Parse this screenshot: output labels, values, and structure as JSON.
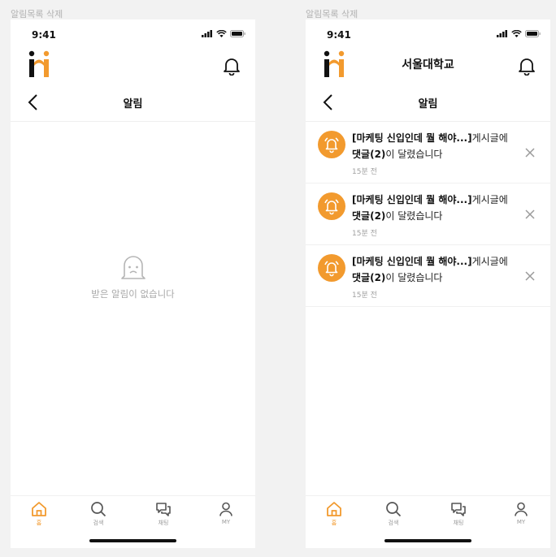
{
  "colors": {
    "accent": "#f29a2e",
    "logo_dark": "#111111"
  },
  "frames": [
    {
      "label": "알림목록 삭제",
      "status_time": "9:41",
      "header_title": "",
      "page_title": "알림",
      "empty_text": "받은 알림이 없습니다",
      "tabs": [
        "홈",
        "검색",
        "채팅",
        "MY"
      ]
    },
    {
      "label": "알림목록 삭제",
      "status_time": "9:41",
      "header_title": "서울대학교",
      "page_title": "알림",
      "notifications": [
        {
          "post_title": "[마케팅 신입인데 뭘 해야...]",
          "suffix_1": "게시글에",
          "comment": "댓글(2)",
          "suffix_2": "이 달렸습니다",
          "time": "15분 전"
        },
        {
          "post_title": "[마케팅 신입인데 뭘 해야...]",
          "suffix_1": "게시글에",
          "comment": "댓글(2)",
          "suffix_2": "이 달렸습니다",
          "time": "15분 전"
        },
        {
          "post_title": "[마케팅 신입인데 뭘 해야...]",
          "suffix_1": "게시글에",
          "comment": "댓글(2)",
          "suffix_2": "이 달렸습니다",
          "time": "15분 전"
        }
      ],
      "tabs": [
        "홈",
        "검색",
        "채팅",
        "MY"
      ]
    }
  ],
  "icons": [
    "signal-icon",
    "wifi-icon",
    "battery-icon",
    "logo-icon",
    "bell-icon",
    "back-arrow-icon",
    "ghost-bell-icon",
    "alarm-bell-icon",
    "close-icon",
    "home-icon",
    "search-icon",
    "chat-icon",
    "user-icon"
  ]
}
